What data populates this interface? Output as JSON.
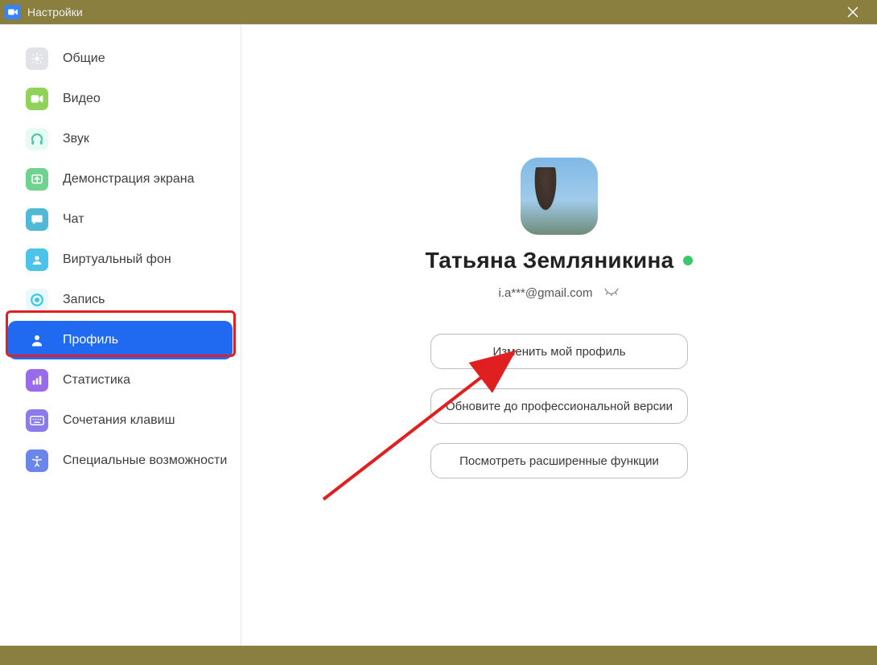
{
  "titlebar": {
    "title": "Настройки"
  },
  "sidebar": {
    "items": [
      {
        "label": "Общие",
        "color": "#d8dbe0",
        "icon": "gear"
      },
      {
        "label": "Видео",
        "color": "#8ed05a",
        "icon": "camera"
      },
      {
        "label": "Звук",
        "color": "#7ad5c0",
        "icon": "headphones"
      },
      {
        "label": "Демонстрация экрана",
        "color": "#6fd38d",
        "icon": "share"
      },
      {
        "label": "Чат",
        "color": "#4fb9d6",
        "icon": "chat"
      },
      {
        "label": "Виртуальный фон",
        "color": "#4cc3e8",
        "icon": "vbg"
      },
      {
        "label": "Запись",
        "color": "#3cc7e8",
        "icon": "record"
      },
      {
        "label": "Профиль",
        "color": "#1f6af0",
        "icon": "person",
        "selected": true
      },
      {
        "label": "Статистика",
        "color": "#9a6be8",
        "icon": "stats"
      },
      {
        "label": "Сочетания клавиш",
        "color": "#8a7bea",
        "icon": "keyboard"
      },
      {
        "label": "Специальные возможности",
        "color": "#6b86ea",
        "icon": "accessibility"
      }
    ]
  },
  "profile": {
    "name": "Татьяна Земляникина",
    "email": "i.a***@gmail.com",
    "buttons": {
      "edit": "Изменить мой профиль",
      "upgrade": "Обновите до профессиональной версии",
      "advanced": "Посмотреть расширенные функции"
    }
  }
}
